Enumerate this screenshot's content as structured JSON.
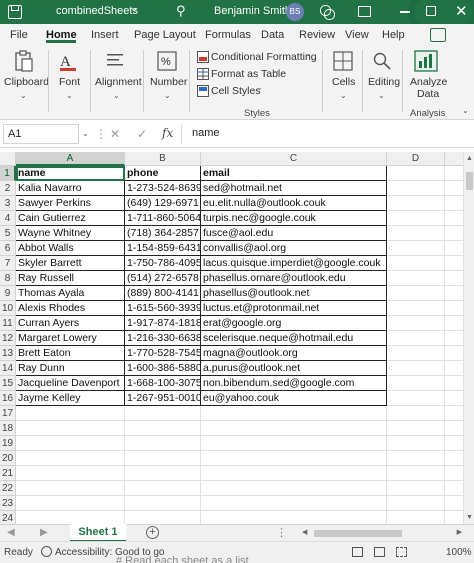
{
  "app": {
    "workbook_name": "combinedSheets",
    "user_name": "Benjamin Smith",
    "user_initials": "BS",
    "accent_color": "#217346"
  },
  "menu_tabs": [
    "File",
    "Home",
    "Insert",
    "Page Layout",
    "Formulas",
    "Data",
    "Review",
    "View",
    "Help"
  ],
  "active_tab": "Home",
  "ribbon": {
    "clipboard": "Clipboard",
    "font": "Font",
    "alignment": "Alignment",
    "number": "Number",
    "conditional_formatting": "Conditional Formatting",
    "format_as_table": "Format as Table",
    "cell_styles": "Cell Styles",
    "styles_group": "Styles",
    "cells": "Cells",
    "editing": "Editing",
    "analyze_data_line1": "Analyze",
    "analyze_data_line2": "Data",
    "analysis_group": "Analysis"
  },
  "formula_bar": {
    "name_box": "A1",
    "fx": "fx",
    "content": "name"
  },
  "columns": [
    "A",
    "B",
    "C",
    "D"
  ],
  "rows": [
    "1",
    "2",
    "3",
    "4",
    "5",
    "6",
    "7",
    "8",
    "9",
    "10",
    "11",
    "12",
    "13",
    "14",
    "15",
    "16",
    "17",
    "18",
    "19",
    "20",
    "21",
    "22",
    "23",
    "24"
  ],
  "table": {
    "headers": [
      "name",
      "phone",
      "email"
    ],
    "data": [
      [
        "Kalia Navarro",
        "1-273-524-8639",
        "sed@hotmail.net"
      ],
      [
        "Sawyer Perkins",
        "(649) 129-6971",
        "eu.elit.nulla@outlook.couk"
      ],
      [
        "Cain Gutierrez",
        "1-711-860-5064",
        "turpis.nec@google.couk"
      ],
      [
        "Wayne Whitney",
        "(718) 364-2857",
        "fusce@aol.edu"
      ],
      [
        "Abbot Walls",
        "1-154-859-6431",
        "convallis@aol.org"
      ],
      [
        "Skyler Barrett",
        "1-750-786-4095",
        "lacus.quisque.imperdiet@google.couk"
      ],
      [
        "Ray Russell",
        "(514) 272-6578",
        "phasellus.ornare@outlook.edu"
      ],
      [
        "Thomas Ayala",
        "(889) 800-4141",
        "phasellus@outlook.net"
      ],
      [
        "Alexis Rhodes",
        "1-615-560-3939",
        "luctus.et@protonmail.net"
      ],
      [
        "Curran Ayers",
        "1-917-874-1818",
        "erat@google.org"
      ],
      [
        "Margaret Lowery",
        "1-216-330-6638",
        "scelerisque.neque@hotmail.edu"
      ],
      [
        "Brett Eaton",
        "1-770-528-7545",
        "magna@outlook.org"
      ],
      [
        "Ray Dunn",
        "1-600-386-5880",
        "a.purus@outlook.net"
      ],
      [
        "Jacqueline Davenport",
        "1-668-100-3075",
        "non.bibendum.sed@google.com"
      ],
      [
        "Jayme Kelley",
        "1-267-951-0010",
        "eu@yahoo.couk"
      ]
    ]
  },
  "sheets": [
    "Sheet 1"
  ],
  "status": {
    "ready": "Ready",
    "accessibility": "Accessibility: Good to go",
    "zoom": "100%"
  },
  "background_text": "# Read each sheet as a list"
}
